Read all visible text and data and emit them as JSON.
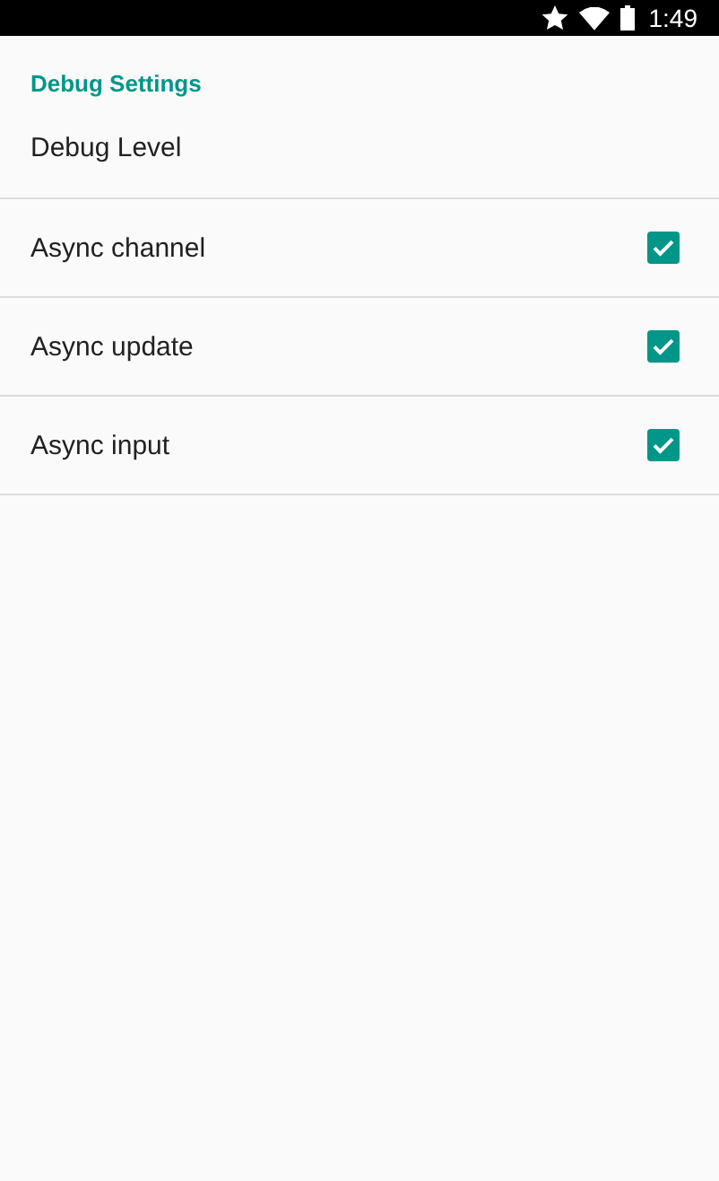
{
  "status_bar": {
    "time": "1:49"
  },
  "section_header": "Debug Settings",
  "items": [
    {
      "kind": "plain",
      "title": "Debug Level"
    },
    {
      "kind": "checkbox",
      "title": "Async channel",
      "checked": true
    },
    {
      "kind": "checkbox",
      "title": "Async update",
      "checked": true
    },
    {
      "kind": "checkbox",
      "title": "Async input",
      "checked": true
    }
  ]
}
